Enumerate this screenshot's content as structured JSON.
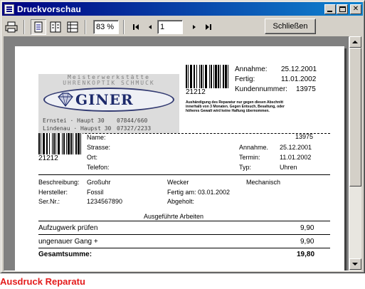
{
  "window": {
    "title": "Druckvorschau"
  },
  "toolbar": {
    "zoom_value": "83 %",
    "page_value": "1",
    "close_label": "Schließen",
    "icons": [
      "print-icon",
      "single-page-icon",
      "two-page-icon",
      "multi-page-icon",
      "first-page-icon",
      "previous-page-icon",
      "next-page-icon",
      "last-page-icon"
    ]
  },
  "page": {
    "logo": {
      "tagline": "Meisterwerkstätte",
      "subtitle": "UHRENKOPTIK SCHMUCK",
      "brand": "GINER",
      "address1": "Ernstei · Haupt 30",
      "phone1": "07844/660",
      "address2": "Lindenau · Haupst 30",
      "phone2": "07327/2233"
    },
    "top_barcode": "21212",
    "top_info": [
      {
        "label": "Annahme:",
        "value": "25.12.2001"
      },
      {
        "label": "Fertig:",
        "value": "11.01.2002"
      },
      {
        "label": "Kundennummer:",
        "value": "13975"
      }
    ],
    "fine_print": "Aushändigung des Reparatur nur gegen diesen Abschnitt innerhalb von 3 Monaten. Gegen Entsuch, Besaltung, oder höheres Gewalt wird keine Haftung übernommen.",
    "mid_barcode": "21212",
    "customer_fields": [
      "Name:",
      "Strasse:",
      "Ort:",
      "Telefon:"
    ],
    "customer_number": "13975",
    "mid_info": [
      {
        "label": "Annahme.",
        "value": "25.12.2001"
      },
      {
        "label": "Termin:",
        "value": "11.01.2002"
      },
      {
        "label": "Typ:",
        "value": "Uhren"
      }
    ],
    "details": {
      "beschreibung_label": "Beschreibung:",
      "beschreibung_value": "Großuhr",
      "hersteller_label": "Hersteller:",
      "hersteller_value": "Fossil",
      "sernr_label": "Ser.Nr.:",
      "sernr_value": "1234567890",
      "wecker": "Wecker",
      "mechanisch": "Mechanisch",
      "fertig_am": "Fertig am: 03.01.2002",
      "abgeholt": "Abgeholt:"
    },
    "work_heading": "Ausgeführte Arbeiten",
    "work_items": [
      {
        "desc": "Aufzugwerk prüfen",
        "price": "9,90"
      },
      {
        "desc": "ungenauer Gang +",
        "price": "9,90"
      }
    ],
    "total_label": "Gesamtsumme:",
    "total_value": "19,80"
  },
  "footer": {
    "label": "Ausdruck Reparatu"
  },
  "colors": {
    "title_bar": "#000080",
    "footer_text": "#e31b1b",
    "brand": "#1d2a6b"
  }
}
